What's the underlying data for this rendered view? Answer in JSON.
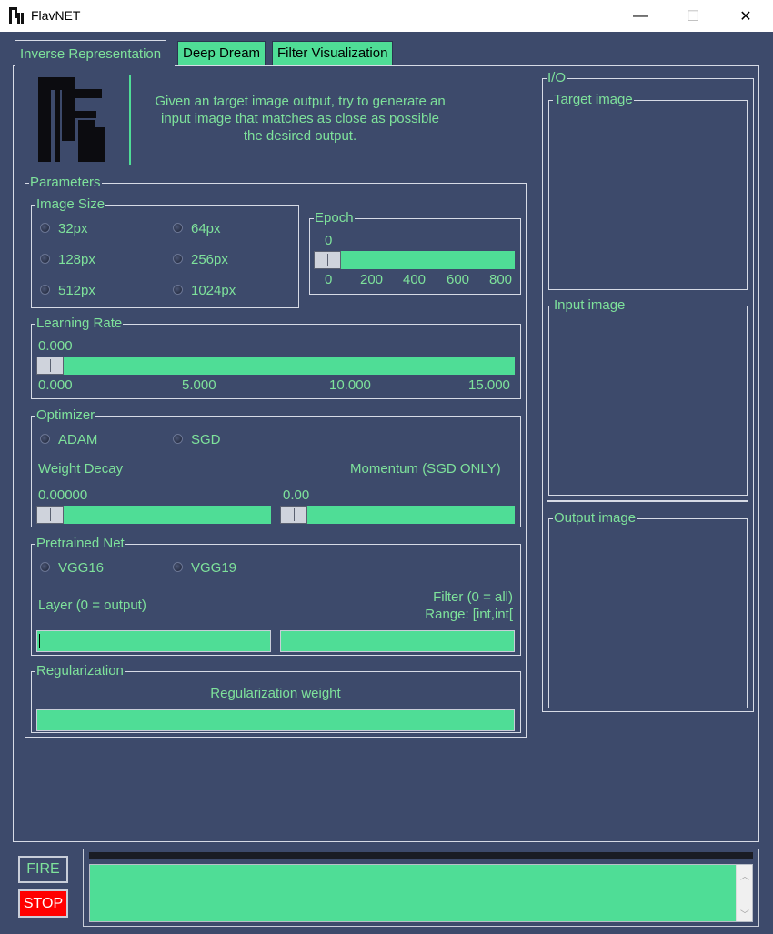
{
  "window": {
    "title": "FlavNET",
    "minimize": "—",
    "maximize": "☐",
    "close": "✕"
  },
  "tabs": [
    {
      "label": "Inverse Representation",
      "active": true
    },
    {
      "label": "Deep Dream",
      "active": false
    },
    {
      "label": "Filter Visualization",
      "active": false
    }
  ],
  "header": {
    "logo_text": "NFN",
    "description_line1": "Given an target image output, try to generate an",
    "description_line2": "input image that matches as close as possible",
    "description_line3": "the desired output."
  },
  "parameters": {
    "label": "Parameters",
    "image_size": {
      "label": "Image Size",
      "options": [
        "32px",
        "64px",
        "128px",
        "256px",
        "512px",
        "1024px"
      ]
    },
    "epoch": {
      "label": "Epoch",
      "value": "0",
      "ticks": [
        "0",
        "200",
        "400",
        "600",
        "800"
      ],
      "fraction": 0.0
    },
    "learning_rate": {
      "label": "Learning Rate",
      "value": "0.000",
      "ticks": [
        "0.000",
        "5.000",
        "10.000",
        "15.000"
      ],
      "fraction": 0.0
    },
    "optimizer": {
      "label": "Optimizer",
      "options": [
        "ADAM",
        "SGD"
      ],
      "weight_decay_label": "Weight Decay",
      "weight_decay_value": "0.00000",
      "momentum_label": "Momentum (SGD ONLY)",
      "momentum_value": "0.00"
    },
    "pretrained": {
      "label": "Pretrained Net",
      "options": [
        "VGG16",
        "VGG19"
      ],
      "layer_label": "Layer (0 = output)",
      "filter_label_line1": "Filter (0 = all)",
      "filter_label_line2": "Range: [int,int[",
      "layer_value": "",
      "filter_value": ""
    },
    "regularization": {
      "label": "Regularization",
      "weight_label": "Regularization weight",
      "weight_value": ""
    }
  },
  "io": {
    "label": "I/O",
    "target_label": "Target image",
    "input_label": "Input image",
    "output_label": "Output image"
  },
  "controls": {
    "fire_label": "FIRE",
    "stop_label": "STOP",
    "log_text": ""
  },
  "colors": {
    "background": "#3d4a6b",
    "accent": "#4fdd96",
    "text": "#7ee29b",
    "stop": "#ff0000"
  }
}
